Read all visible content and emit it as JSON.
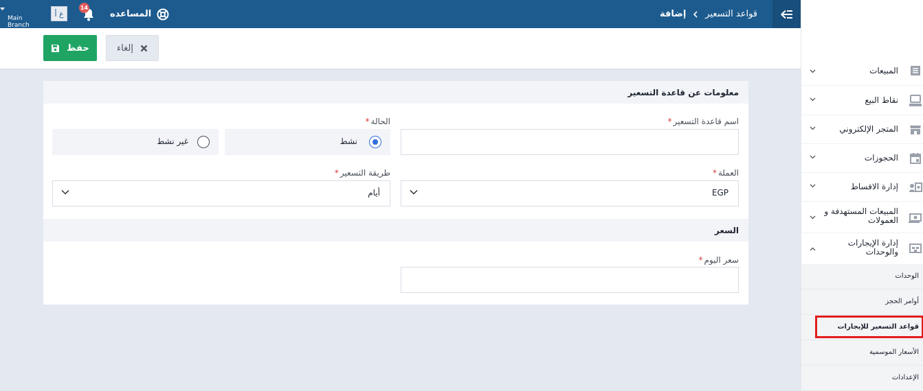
{
  "topbar": {
    "breadcrumb_parent": "قواعد التسعير",
    "breadcrumb_current": "إضافة",
    "help_label": "المساعده",
    "notification_count": "14",
    "lang_label": "ع أ",
    "branch_name": "Main Branch",
    "bg_color": "#1d5b8f"
  },
  "actions": {
    "save_label": "حفظ",
    "cancel_label": "إلغاء",
    "save_color": "#1fa463"
  },
  "form": {
    "section_info_title": "معلومات عن قاعدة التسعير",
    "name_label": "اسم قاعدة التسعير",
    "name_value": "",
    "status_label": "الحالة",
    "status_options": [
      {
        "label": "نشط",
        "selected": true
      },
      {
        "label": "غير نشط",
        "selected": false
      }
    ],
    "currency_label": "العملة",
    "currency_value": "EGP",
    "pricing_method_label": "طريقة التسعير",
    "pricing_method_value": "أيام",
    "section_price_title": "السعر",
    "day_price_label": "سعر اليوم",
    "day_price_value": "",
    "required_mark": "*"
  },
  "sidebar": {
    "items": [
      {
        "label": "المبيعات",
        "icon": "sales-list-icon"
      },
      {
        "label": "نقاط البيع",
        "icon": "pos-terminal-icon"
      },
      {
        "label": "المتجر الإلكتروني",
        "icon": "store-icon"
      },
      {
        "label": "الحجوزات",
        "icon": "calendar-icon"
      },
      {
        "label": "إدارة الاقساط",
        "icon": "installments-icon"
      },
      {
        "label": "المبيعات المستهدفة و العمولات",
        "icon": "money-icon"
      },
      {
        "label": "إدارة الإيجارات والوحدات",
        "icon": "rentals-icon",
        "expanded": true
      }
    ],
    "sub_items": [
      {
        "label": "الوحدات"
      },
      {
        "label": "أوامر الحجز"
      },
      {
        "label": "قواعد التسعير للإيجارات",
        "active": true
      },
      {
        "label": "الأسعار الموسمية"
      },
      {
        "label": "الإعدادات"
      }
    ],
    "highlight_color": "#e41b1b"
  }
}
